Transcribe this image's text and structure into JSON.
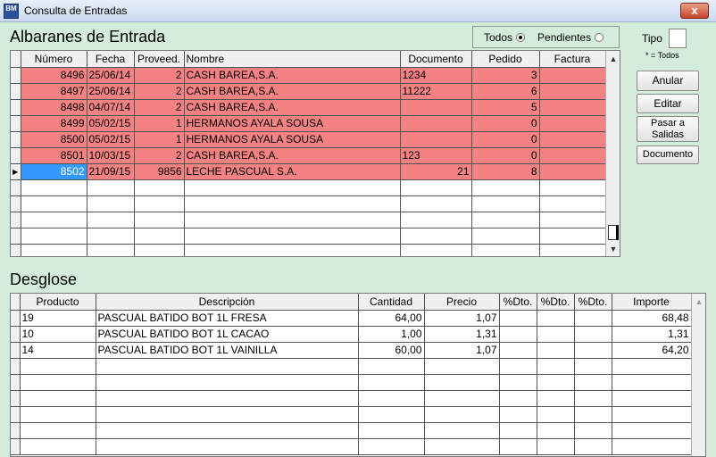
{
  "window": {
    "title": "Consulta de Entradas",
    "icon_text": "BM",
    "close_label": "x"
  },
  "albaranes": {
    "heading": "Albaranes de Entrada",
    "columns": [
      "Número",
      "Fecha",
      "Proveed.",
      "Nombre",
      "Documento",
      "Pedido",
      "Factura"
    ],
    "rows": [
      {
        "numero": "8496",
        "fecha": "25/06/14",
        "proveed": "2",
        "nombre": "CASH BAREA,S.A.",
        "documento": "1234",
        "pedido": "3",
        "factura": ""
      },
      {
        "numero": "8497",
        "fecha": "25/06/14",
        "proveed": "2",
        "nombre": "CASH BAREA,S.A.",
        "documento": "11222",
        "pedido": "6",
        "factura": ""
      },
      {
        "numero": "8498",
        "fecha": "04/07/14",
        "proveed": "2",
        "nombre": "CASH BAREA,S.A.",
        "documento": "",
        "pedido": "5",
        "factura": ""
      },
      {
        "numero": "8499",
        "fecha": "05/02/15",
        "proveed": "1",
        "nombre": "HERMANOS AYALA SOUSA",
        "documento": "",
        "pedido": "0",
        "factura": ""
      },
      {
        "numero": "8500",
        "fecha": "05/02/15",
        "proveed": "1",
        "nombre": "HERMANOS AYALA SOUSA",
        "documento": "",
        "pedido": "0",
        "factura": ""
      },
      {
        "numero": "8501",
        "fecha": "10/03/15",
        "proveed": "2",
        "nombre": "CASH BAREA,S.A.",
        "documento": "123",
        "pedido": "0",
        "factura": ""
      },
      {
        "numero": "8502",
        "fecha": "21/09/15",
        "proveed": "9856",
        "nombre": "LECHE PASCUAL S.A.",
        "documento": "21",
        "pedido": "8",
        "factura": ""
      }
    ]
  },
  "filter": {
    "todos_label": "Todos",
    "pendientes_label": "Pendientes",
    "selected": "Todos"
  },
  "tipo": {
    "label": "Tipo",
    "value": "",
    "hint": "* = Todos"
  },
  "buttons": {
    "anular": "Anular",
    "editar": "Editar",
    "pasar_line1": "Pasar a",
    "pasar_line2": "Salidas",
    "documento": "Documento"
  },
  "desglose": {
    "heading": "Desglose",
    "columns": [
      "Producto",
      "Descripción",
      "Cantidad",
      "Precio",
      "%Dto.",
      "%Dto.",
      "%Dto.",
      "Importe"
    ],
    "rows": [
      {
        "producto": "19",
        "descripcion": "PASCUAL BATIDO BOT 1L FRESA",
        "cantidad": "64,00",
        "precio": "1,07",
        "dto1": "",
        "dto2": "",
        "dto3": "",
        "importe": "68,48"
      },
      {
        "producto": "10",
        "descripcion": "PASCUAL BATIDO BOT 1L CACAO",
        "cantidad": "1,00",
        "precio": "1,31",
        "dto1": "",
        "dto2": "",
        "dto3": "",
        "importe": "1,31"
      },
      {
        "producto": "14",
        "descripcion": "PASCUAL BATIDO BOT 1L VAINILLA",
        "cantidad": "60,00",
        "precio": "1,07",
        "dto1": "",
        "dto2": "",
        "dto3": "",
        "importe": "64,20"
      }
    ]
  },
  "colors": {
    "background": "#d4ecdc",
    "row_highlight": "#f48282",
    "selection": "#3399ff"
  }
}
